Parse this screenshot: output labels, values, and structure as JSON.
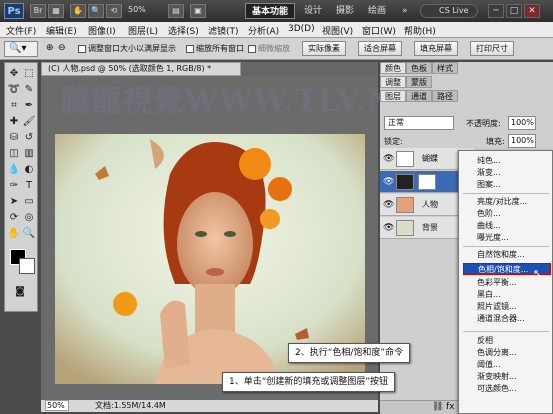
{
  "app": {
    "logo": "Ps",
    "zoom": "50%",
    "workspaces": [
      "基本功能",
      "设计",
      "摄影",
      "绘画"
    ],
    "more": "»",
    "cs_live": "CS Live",
    "win_controls": [
      "─",
      "□",
      "✕"
    ]
  },
  "menubar": [
    "文件(F)",
    "编辑(E)",
    "图像(I)",
    "图层(L)",
    "选择(S)",
    "滤镜(T)",
    "分析(A)",
    "3D(D)",
    "视图(V)",
    "窗口(W)",
    "帮助(H)"
  ],
  "options": {
    "checkbox1": "调整窗口大小以满屏显示",
    "checkbox2": "缩放所有窗口",
    "checkbox3": "细微缩放",
    "btn_actual": "实际像素",
    "btn_fit": "适合屏幕",
    "btn_fill": "填充屏幕",
    "btn_print": "打印尺寸"
  },
  "document": {
    "tab": "(C) 人物.psd @ 50% (选取颜色 1, RGB/8) *",
    "zoom": "50%",
    "status": "文档:1.55M/14.4M"
  },
  "watermark": "騰龍視覺WWW.TLV.NET",
  "panels": {
    "tabs_top": [
      "颜色",
      "色板",
      "样式"
    ],
    "tabs_mid": [
      "调整",
      "蒙版"
    ],
    "tabs_layers": [
      "图层",
      "通道",
      "路径"
    ],
    "blend_mode": "正常",
    "opacity_label": "不透明度:",
    "opacity": "100%",
    "fill_label": "填充:",
    "fill": "100%",
    "lock_label": "锁定:",
    "layers": [
      {
        "name": "蝴蝶",
        "selected": false
      },
      {
        "name": "",
        "selected": true
      },
      {
        "name": "人物",
        "selected": false
      },
      {
        "name": "背景",
        "selected": false
      }
    ]
  },
  "context_menu": {
    "items": [
      "纯色...",
      "渐变...",
      "图案...",
      "|",
      "亮度/对比度...",
      "色阶...",
      "曲线...",
      "曝光度...",
      "|",
      "自然饱和度...",
      "色相/饱和度...",
      "色彩平衡...",
      "黑白...",
      "照片滤镜...",
      "通道混合器...",
      "|",
      "反相",
      "色调分离...",
      "阈值...",
      "渐变映射...",
      "可选颜色..."
    ],
    "highlighted": "色相/饱和度..."
  },
  "callouts": {
    "step2": "2、执行“色相/饱和度”命令",
    "step1": "1、单击“创建新的填充或调整图层”按钮"
  },
  "colors": {
    "highlight": "#1a4fb3",
    "foreground": "#000000",
    "background": "#ffffff"
  }
}
